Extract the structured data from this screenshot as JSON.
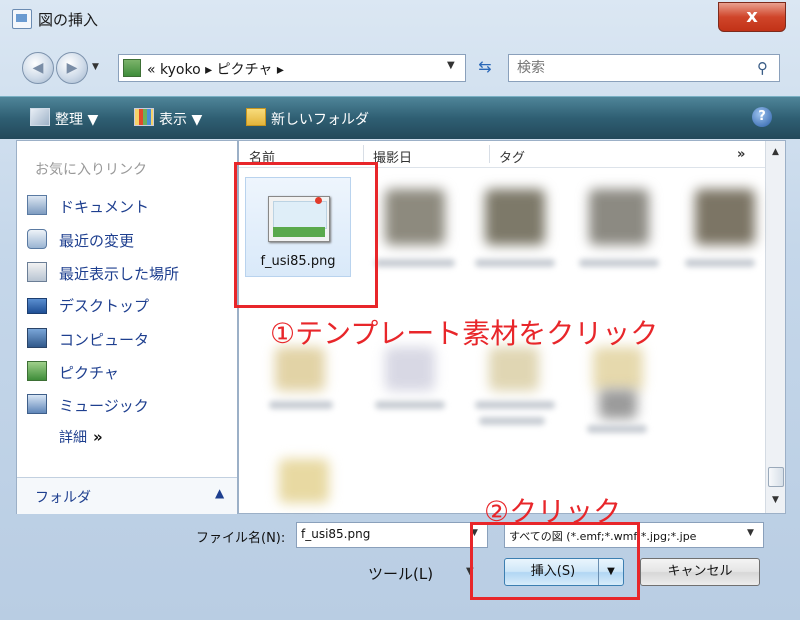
{
  "window": {
    "title": "図の挿入",
    "close_label": "x"
  },
  "nav": {
    "back_glyph": "◀",
    "forward_glyph": "▶",
    "address_path": "« kyoko ▸ ピクチャ ▸",
    "search_placeholder": "検索"
  },
  "toolbar": {
    "organize": "整理 ▼",
    "view": "表示 ▼",
    "new_folder": "新しいフォルダ",
    "help": "?"
  },
  "sidebar": {
    "favorites_title": "お気に入りリンク",
    "items": [
      {
        "label": "ドキュメント",
        "icon": "document-icon"
      },
      {
        "label": "最近の変更",
        "icon": "recent-changes-icon"
      },
      {
        "label": "最近表示した場所",
        "icon": "recent-places-icon"
      },
      {
        "label": "デスクトップ",
        "icon": "desktop-icon"
      },
      {
        "label": "コンピュータ",
        "icon": "computer-icon"
      },
      {
        "label": "ピクチャ",
        "icon": "pictures-icon"
      },
      {
        "label": "ミュージック",
        "icon": "music-icon"
      }
    ],
    "more": "詳細",
    "more_glyph": "»",
    "folders": "フォルダ",
    "folders_glyph": "▲"
  },
  "columns": {
    "name": "名前",
    "date": "撮影日",
    "tag": "タグ",
    "more": "»"
  },
  "selected_file": {
    "name": "f_usi85.png"
  },
  "bottom": {
    "filename_label": "ファイル名(N):",
    "filename_value": "f_usi85.png",
    "filetype_value": "すべての図 (*.emf;*.wmf;*.jpg;*.jpe",
    "tools": "ツール(L)",
    "insert": "挿入(S)",
    "cancel": "キャンセル"
  },
  "annotations": {
    "step1": "①テンプレート素材をクリック",
    "step2": "②クリック"
  },
  "colors": {
    "highlight": "#e8262a",
    "toolbar": "#2f5f73"
  }
}
